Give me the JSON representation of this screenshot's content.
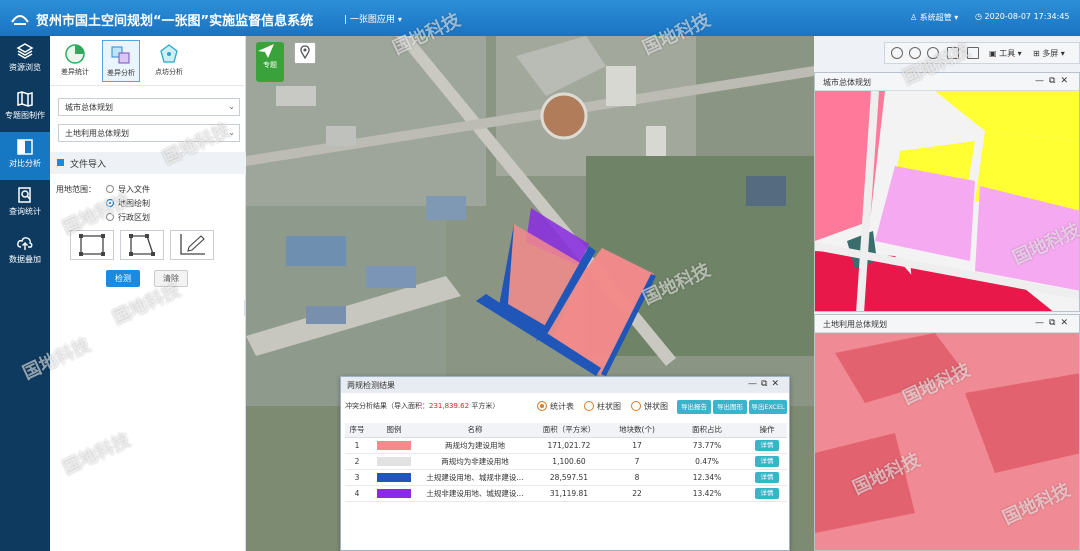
{
  "header": {
    "title": "贺州市国土空间规划“一张图”实施监督信息系统",
    "subtitle": "| 一张图应用",
    "user": "系统超管",
    "datetime": "2020-08-07  17:34:45"
  },
  "nav": {
    "items": [
      {
        "label": "资源浏览",
        "icon": "layers-icon"
      },
      {
        "label": "专题图制作",
        "icon": "map-book-icon"
      },
      {
        "label": "对比分析",
        "icon": "compare-icon"
      },
      {
        "label": "查询统计",
        "icon": "query-icon"
      },
      {
        "label": "数据叠加",
        "icon": "cloud-upload-icon"
      }
    ],
    "active_index": 2
  },
  "panel": {
    "tools": [
      {
        "label": "差异统计",
        "icon": "pie-icon"
      },
      {
        "label": "差异分析",
        "icon": "diff-icon"
      },
      {
        "label": "点坊分析",
        "icon": "point-icon"
      }
    ],
    "select1": "城市总体规划",
    "select2": "土地利用总体规划",
    "section": "文件导入",
    "range_label": "用地范围：",
    "options": [
      "导入文件",
      "地图绘制",
      "行政区划"
    ],
    "selected_option": "地图绘制",
    "detect_label": "检测",
    "clear_label": "清除"
  },
  "map": {
    "tool_label": "专题"
  },
  "right_toolbar": {
    "tools_label": "工具",
    "multi_label": "多屏"
  },
  "windows": {
    "top_title": "城市总体规划",
    "bottom_title": "土地利用总体规划"
  },
  "dialog": {
    "title": "两规检测结果",
    "summary_prefix": "冲突分析结果（导入面积：",
    "summary_value": "231,839.62",
    "summary_suffix": "平方米）",
    "chart_options": [
      "统计表",
      "柱状图",
      "饼状图"
    ],
    "selected_chart": "统计表",
    "export_buttons": [
      "导出报告",
      "导出图形",
      "导出EXCEL"
    ],
    "columns": [
      "序号",
      "图例",
      "名称",
      "面积（平方米）",
      "地块数(个)",
      "面积占比",
      "操作"
    ],
    "rows": [
      {
        "no": "1",
        "color": "#f28b8b",
        "name": "两规均为建设用地",
        "area": "171,021.72",
        "count": "17",
        "ratio": "73.77%",
        "action": "详情"
      },
      {
        "no": "2",
        "color": "#e2e2e2",
        "name": "两规均为非建设用地",
        "area": "1,100.60",
        "count": "7",
        "ratio": "0.47%",
        "action": "详情"
      },
      {
        "no": "3",
        "color": "#1f56b8",
        "name": "土规建设用地、城规非建设...",
        "area": "28,597.51",
        "count": "8",
        "ratio": "12.34%",
        "action": "详情"
      },
      {
        "no": "4",
        "color": "#8a2be2",
        "name": "土规非建设用地、城规建设...",
        "area": "31,119.81",
        "count": "22",
        "ratio": "13.42%",
        "action": "详情"
      }
    ]
  },
  "watermark": "国地科技",
  "colors": {
    "header": "#1a73c1",
    "nav_bg": "#0e3a5f",
    "nav_active": "#1678c2",
    "accent": "#1a8be0",
    "export": "#3bb3c8",
    "radio": "#e07b22"
  }
}
